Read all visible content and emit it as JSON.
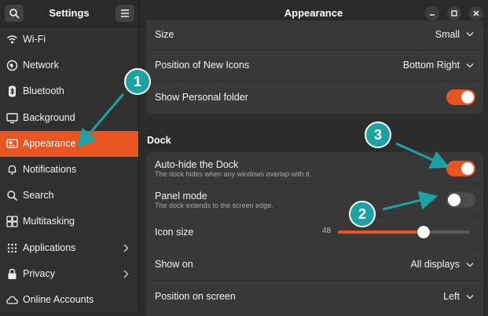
{
  "sidebar": {
    "title": "Settings",
    "items": [
      {
        "label": "Wi-Fi",
        "icon": "wifi-icon"
      },
      {
        "label": "Network",
        "icon": "network-icon"
      },
      {
        "label": "Bluetooth",
        "icon": "bluetooth-icon"
      },
      {
        "label": "Background",
        "icon": "background-icon"
      },
      {
        "label": "Appearance",
        "icon": "appearance-icon",
        "active": true
      },
      {
        "label": "Notifications",
        "icon": "bell-icon"
      },
      {
        "label": "Search",
        "icon": "search-icon"
      },
      {
        "label": "Multitasking",
        "icon": "multitasking-icon"
      },
      {
        "label": "Applications",
        "icon": "grid-icon",
        "submenu": true
      },
      {
        "label": "Privacy",
        "icon": "lock-icon",
        "submenu": true
      },
      {
        "label": "Online Accounts",
        "icon": "cloud-icon"
      }
    ]
  },
  "header": {
    "title": "Appearance"
  },
  "desktop_icons": {
    "size": {
      "label": "Size",
      "value": "Small"
    },
    "position": {
      "label": "Position of New Icons",
      "value": "Bottom Right"
    },
    "personal_folder": {
      "label": "Show Personal folder",
      "on": true
    }
  },
  "dock": {
    "title": "Dock",
    "autohide": {
      "label": "Auto-hide the Dock",
      "subtitle": "The dock hides when any windows overlap with it.",
      "on": true
    },
    "panel_mode": {
      "label": "Panel mode",
      "subtitle": "The dock extends to the screen edge.",
      "on": false
    },
    "icon_size": {
      "label": "Icon size",
      "value": "48",
      "fraction": 0.65
    },
    "show_on": {
      "label": "Show on",
      "value": "All displays"
    },
    "position": {
      "label": "Position on screen",
      "value": "Left"
    }
  },
  "annotations": [
    "1",
    "2",
    "3"
  ],
  "colors": {
    "accent": "#e95420",
    "annotation": "#1ba3a3",
    "sidebar": "#303030",
    "background": "#2c2c2c",
    "card": "#383838"
  }
}
